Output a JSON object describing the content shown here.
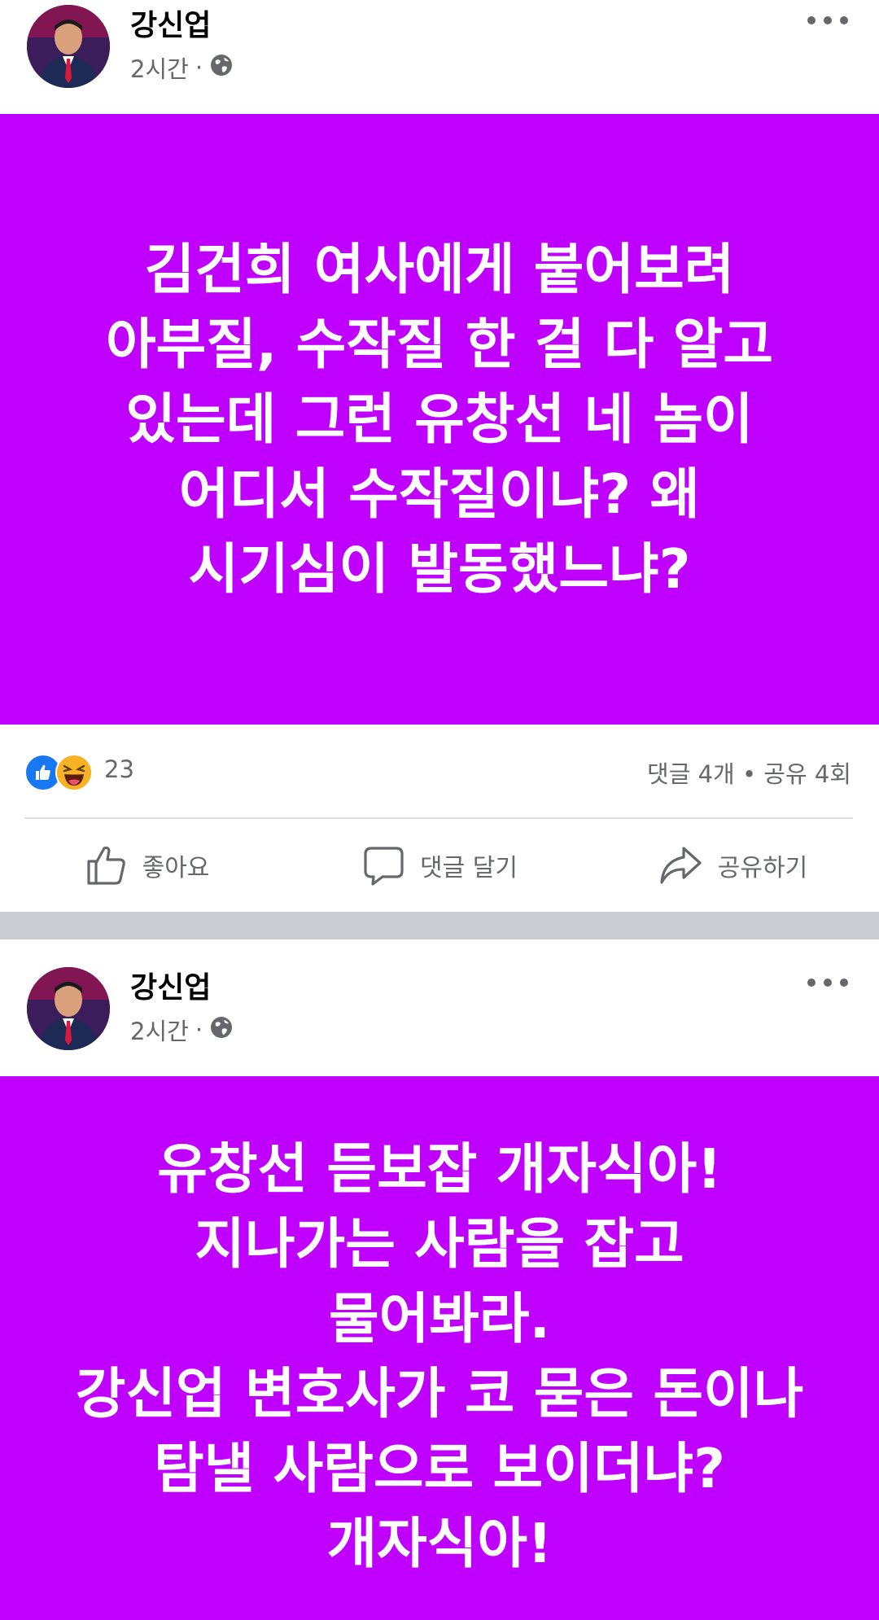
{
  "colors": {
    "post_background": "#bf00ff",
    "post_text": "#ffffff",
    "secondary_text": "#65676b",
    "feed_separator": "#c9ccd1",
    "like_blue": "#1877f2",
    "haha_yellow": "#f7b125"
  },
  "posts": [
    {
      "author": "강신업",
      "time": "2시간",
      "audience_icon": "globe-icon",
      "text_lines": [
        "김건희 여사에게 붙어보려",
        "아부질, 수작질 한 걸 다 알고",
        "있는데 그런  유창선 네 놈이",
        "어디서 수작질이냐? 왜",
        "시기심이 발동했느냐?"
      ],
      "reactions": {
        "icons": [
          "like-icon",
          "haha-icon"
        ],
        "count": "23"
      },
      "comments_shares": "댓글 4개 • 공유 4회",
      "actions": {
        "like": "좋아요",
        "comment": "댓글 달기",
        "share": "공유하기"
      }
    },
    {
      "author": "강신업",
      "time": "2시간",
      "audience_icon": "globe-icon",
      "text_lines": [
        "유창선 듣보잡 개자식아!",
        "지나가는 사람을  잡고",
        "물어봐라.",
        "강신업 변호사가 코 묻은 돈이나",
        "탐낼 사람으로 보이더냐?",
        "개자식아!"
      ]
    }
  ]
}
